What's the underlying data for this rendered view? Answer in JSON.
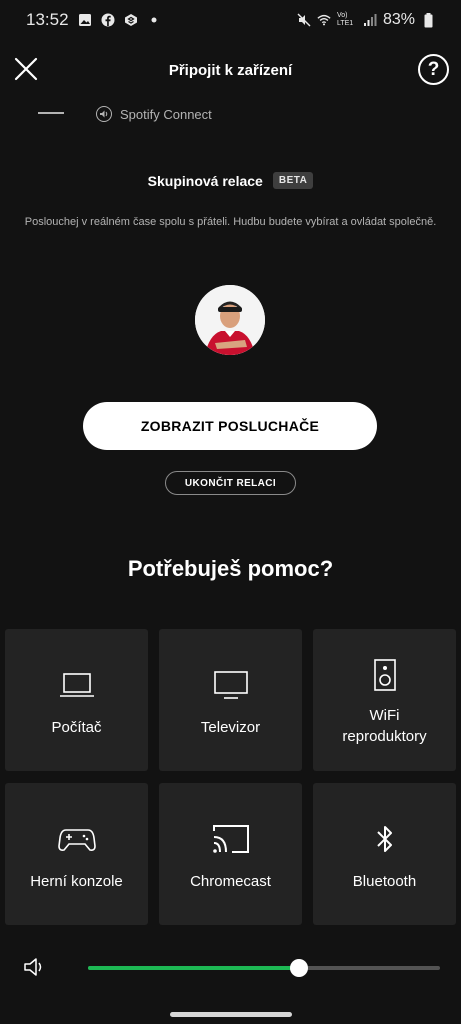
{
  "status_bar": {
    "time": "13:52",
    "battery_percent": "83%",
    "network": "Vo) LTE1"
  },
  "header": {
    "title": "Připojit k zařízení",
    "help_label": "?"
  },
  "current_device": {
    "connect_label": "Spotify Connect"
  },
  "group_session": {
    "title": "Skupinová relace",
    "badge": "BETA",
    "description": "Poslouchej v reálném čase spolu s přáteli. Hudbu budete vybírat a ovládat společně.",
    "primary_button": "ZOBRAZIT POSLUCHAČE",
    "secondary_button": "UKONČIT RELACI"
  },
  "help": {
    "title": "Potřebuješ pomoc?",
    "tiles": [
      {
        "label": "Počítač",
        "icon": "laptop-icon"
      },
      {
        "label": "Televizor",
        "icon": "tv-icon"
      },
      {
        "label": "WiFi\nreproduktory",
        "icon": "speaker-icon"
      },
      {
        "label": "Herní konzole",
        "icon": "gamepad-icon"
      },
      {
        "label": "Chromecast",
        "icon": "cast-icon"
      },
      {
        "label": "Bluetooth",
        "icon": "bluetooth-icon"
      }
    ]
  },
  "volume": {
    "level": 0.6
  },
  "colors": {
    "background": "#121212",
    "tile": "#232323",
    "accent": "#1db954"
  }
}
